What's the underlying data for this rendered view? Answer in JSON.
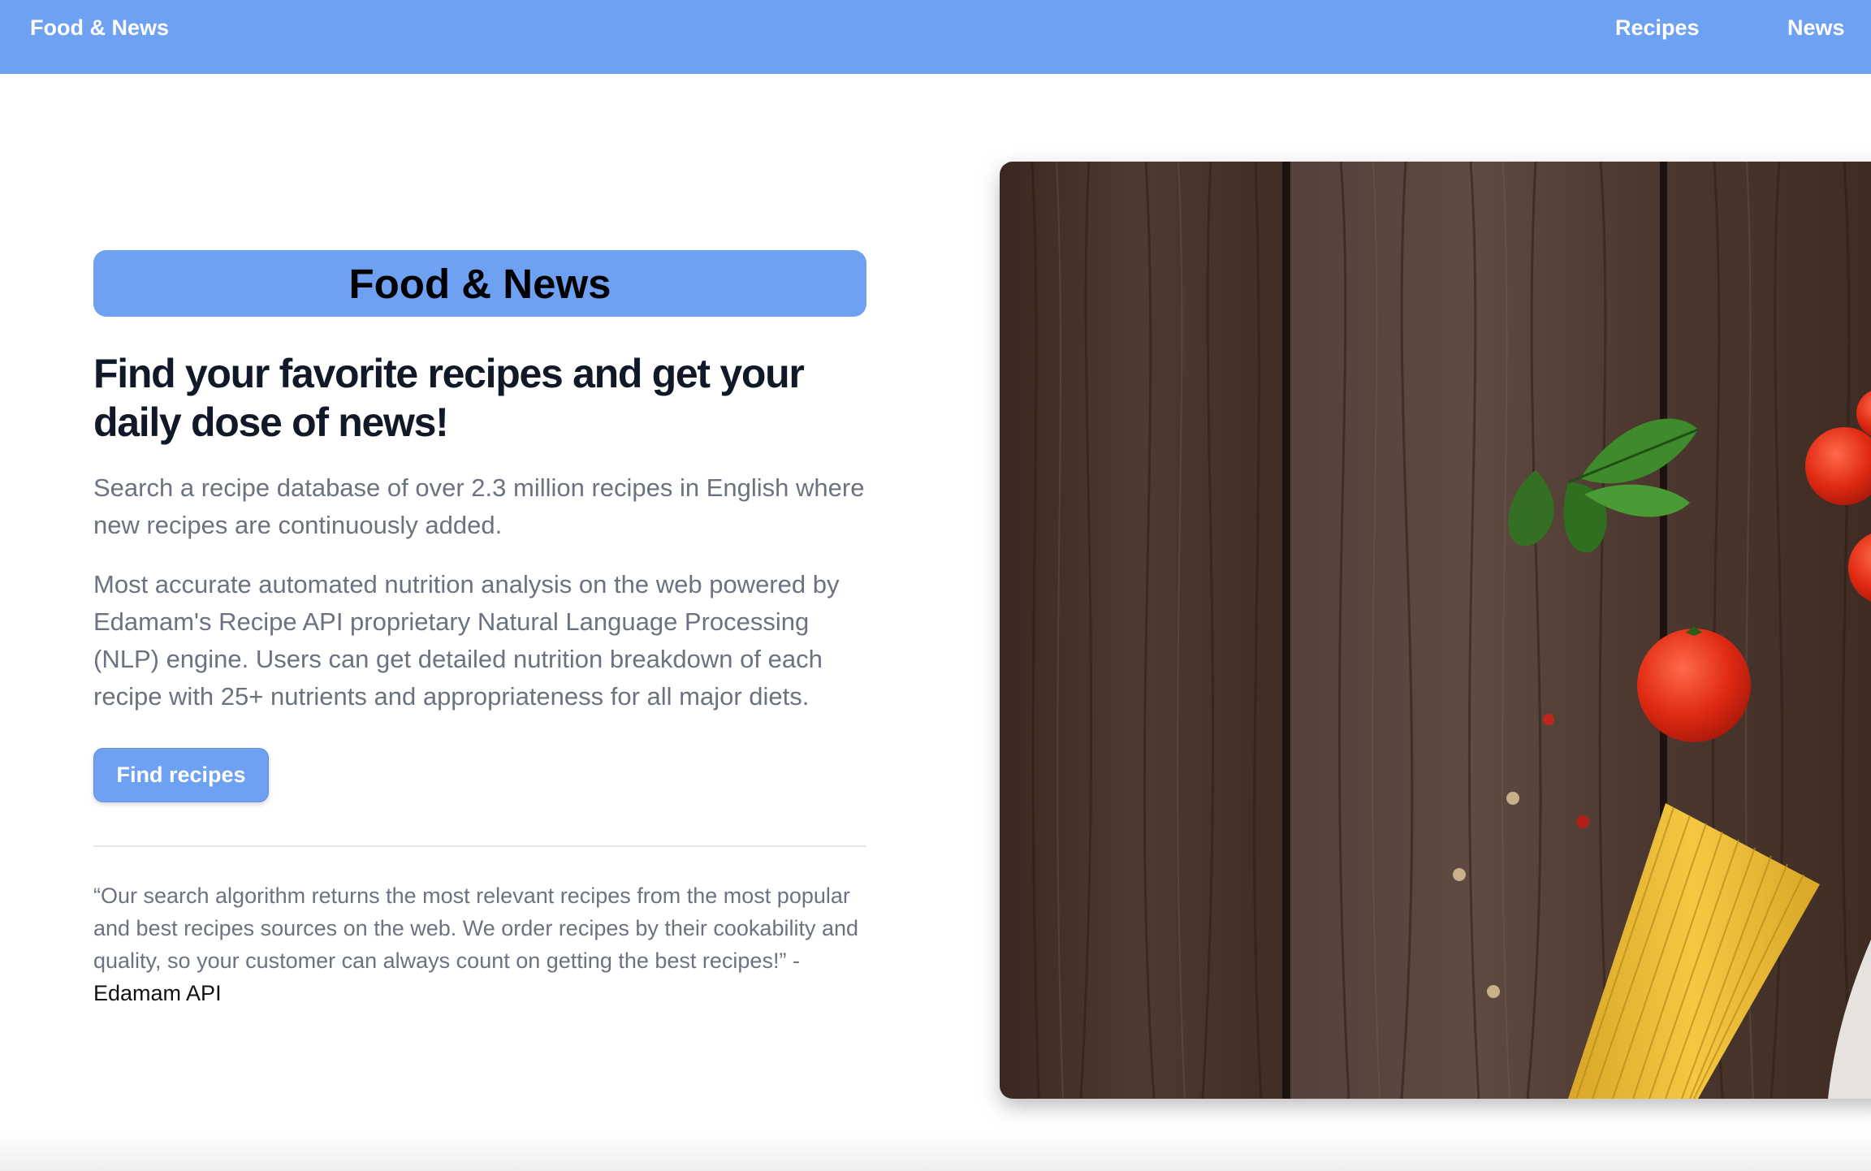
{
  "navbar": {
    "brand": "Food & News",
    "links": [
      {
        "label": "Recipes"
      },
      {
        "label": "News"
      }
    ],
    "color": "#6fa1f3"
  },
  "hero": {
    "badge_title": "Food & News",
    "headline": "Find your favorite recipes and get your daily dose of news!",
    "paragraph_1": "Search a recipe database of over 2.3 million recipes in English where new recipes are continuously added.",
    "paragraph_2": "Most accurate automated nutrition analysis on the web powered by Edamam's Recipe API proprietary Natural Language Processing (NLP) engine. Users can get detailed nutrition breakdown of each recipe with 25+ nutrients and appropriateness for all major diets.",
    "cta_label": "Find recipes",
    "quote_text": "“Our search algorithm returns the most relevant recipes from the most popular and best recipes sources on the web. We order recipes by their cookability and quality, so your customer can always count on getting the best recipes!” - ",
    "quote_source": "Edamam API"
  },
  "image": {
    "icon": "wooden-table-food-photo",
    "items": [
      "basil-leaves",
      "cherry-tomatoes",
      "spaghetti",
      "peppercorns",
      "cloth"
    ]
  }
}
